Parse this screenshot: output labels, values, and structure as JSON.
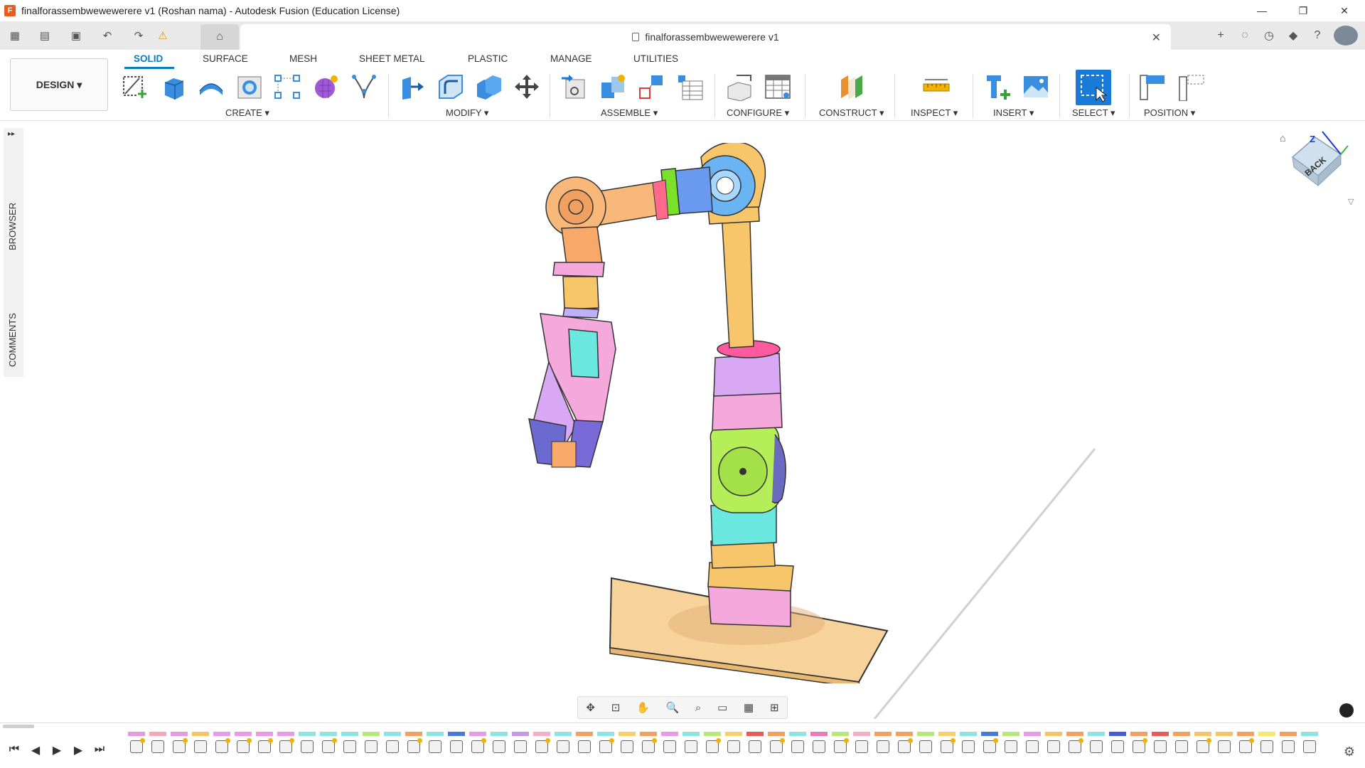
{
  "window": {
    "title": "finalforassembwewewerere v1 (Roshan nama) - Autodesk Fusion (Education License)",
    "app_icon": "F",
    "minimize": "—",
    "restore": "❐",
    "close": "✕"
  },
  "doc_tab": {
    "name": "finalforassembwewewerere v1",
    "close": "✕"
  },
  "quick_access": {
    "grid": "▦",
    "file": "▤",
    "save": "▣",
    "undo": "↶",
    "redo": "↷",
    "warning": "⚠",
    "home": "⌂"
  },
  "qat_right": {
    "new_tab": "+",
    "extensions": "◌",
    "job_status": "◷",
    "notifications": "◆",
    "help": "?"
  },
  "toolbar": {
    "design_label": "DESIGN ▾",
    "tabs": [
      "SOLID",
      "SURFACE",
      "MESH",
      "SHEET METAL",
      "PLASTIC",
      "MANAGE",
      "UTILITIES"
    ],
    "groups": [
      "CREATE ▾",
      "MODIFY ▾",
      "ASSEMBLE ▾",
      "CONFIGURE ▾",
      "CONSTRUCT ▾",
      "INSPECT ▾",
      "INSERT ▾",
      "SELECT ▾",
      "POSITION ▾"
    ]
  },
  "side_panel": {
    "browser": "BROWSER",
    "comments": "COMMENTS",
    "expand": "▸▸"
  },
  "viewcube": {
    "face": "BACK",
    "axis": "Z"
  },
  "nav_bar": {
    "orbit": "✥",
    "look": "⊡",
    "pan": "✋",
    "zoom": "🔍",
    "zoom_window": "⌕",
    "display": "▭",
    "grid": "▦",
    "viewports": "⊞"
  },
  "timeline": {
    "first": "⏮",
    "prev": "◀",
    "play": "▶",
    "next": "▶",
    "last": "⏭",
    "settings": "⚙",
    "strip_colors": [
      "#e59ae0",
      "#f4a8b8",
      "#e69ae0",
      "#f6c36a",
      "#e89ce8",
      "#e89ce8",
      "#e89ce8",
      "#e89ce8",
      "#8ee4e0",
      "#8ee4e0",
      "#8ee4e0",
      "#b8e87a",
      "#8ee4e0",
      "#f2a060",
      "#8ee4e0",
      "#4a7ad8",
      "#e89ce8",
      "#8ee4e0",
      "#c49ae6",
      "#f4b0c8",
      "#8ee4e0",
      "#f2a060",
      "#8ee4e0",
      "#f6d06a",
      "#f2a060",
      "#e89ce8",
      "#8ee4e0",
      "#b8e87a",
      "#f6d06a",
      "#e85a5a",
      "#f2a060",
      "#8ee4e0",
      "#e87ab8",
      "#b8e87a",
      "#f4b0c8",
      "#f2a060",
      "#f2a060",
      "#b8e87a",
      "#f6d06a",
      "#8ee4e0",
      "#4a7ad8",
      "#b8e87a",
      "#e89ce8",
      "#f6c36a",
      "#f2a060",
      "#8ee4e0",
      "#4a5ad0",
      "#f2a060",
      "#e85a5a",
      "#f2a060",
      "#f6c36a",
      "#f6c36a",
      "#f2a060",
      "#f6e870",
      "#f2a060",
      "#8ee4e0"
    ],
    "sparked": [
      0,
      2,
      4,
      5,
      6,
      7,
      9,
      13,
      16,
      19,
      22,
      24,
      27,
      30,
      33,
      36,
      38,
      40,
      44,
      47,
      50,
      52
    ]
  }
}
